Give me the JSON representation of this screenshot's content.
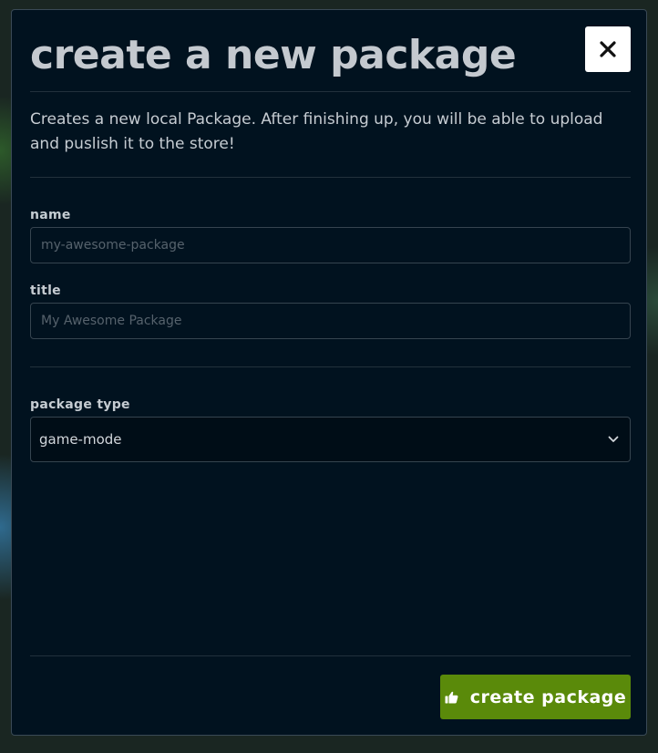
{
  "modal": {
    "title": "create a new package",
    "description": "Creates a new local Package. After finishing up, you will be able to upload and puslish it to the store!"
  },
  "fields": {
    "name": {
      "label": "name",
      "placeholder": "my-awesome-package",
      "value": ""
    },
    "title": {
      "label": "title",
      "placeholder": "My Awesome Package",
      "value": ""
    },
    "package_type": {
      "label": "package type",
      "selected": "game-mode"
    }
  },
  "actions": {
    "create_label": "create package"
  },
  "icons": {
    "close": "close-icon",
    "dropdown": "chevron-down-icon",
    "create": "thumbs-up-icon"
  },
  "colors": {
    "modal_background": "#01121f",
    "primary_button": "#5a8a0a",
    "text": "#c6ccd2",
    "title": "#c4c9cf"
  }
}
